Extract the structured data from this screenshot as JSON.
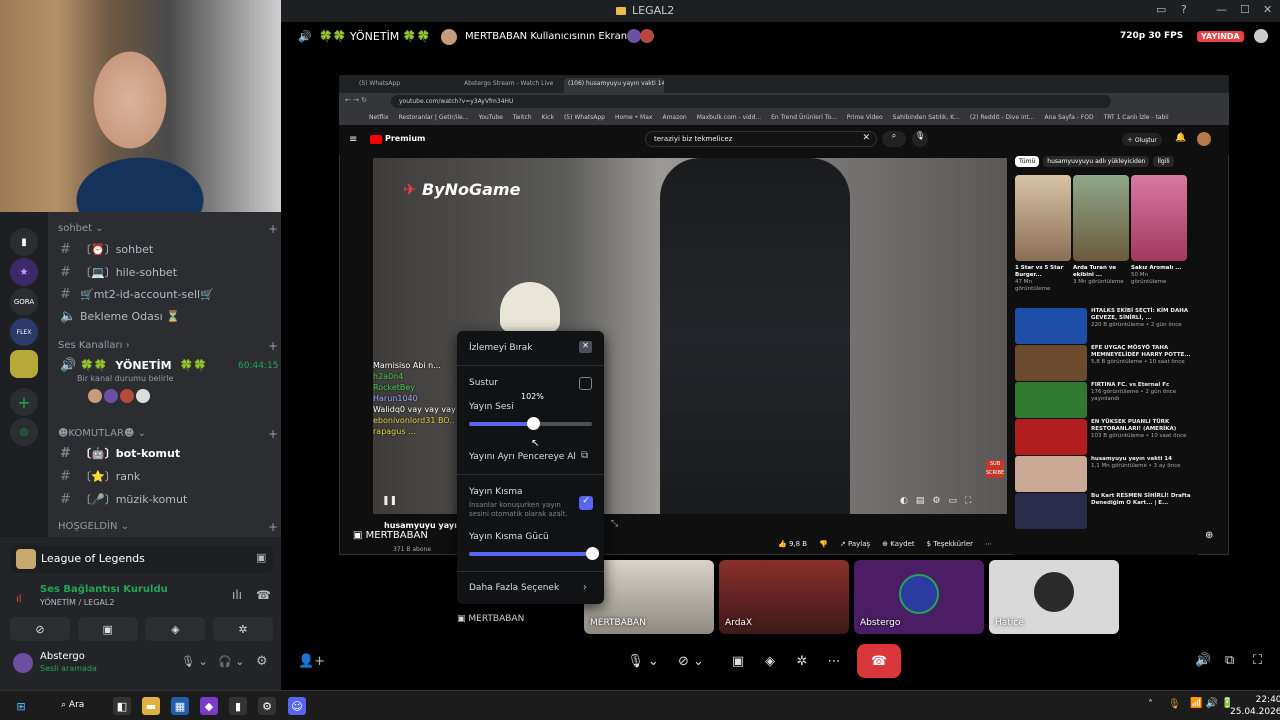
{
  "window": {
    "title": "LEGAL2"
  },
  "sidebar": {
    "categories": {
      "sohbet": "sohbet",
      "voice": "Ses Kanalları",
      "komutlar": "☻KOMUTLAR☻",
      "hosgeldin": "HOŞGELDİN"
    },
    "channels": [
      {
        "label": "〔⏰〕sohbet"
      },
      {
        "label": "〔💻〕hile-sohbet"
      },
      {
        "label": "🛒mt2-id-account-sell🛒"
      },
      {
        "label": "Bekleme Odası ⏳"
      },
      {
        "label": "〔🤖〕bot-komut"
      },
      {
        "label": "〔⭐〕rank"
      },
      {
        "label": "〔🎤〕müzik-komut"
      }
    ],
    "voice_channel": {
      "name": "YÖNETİM",
      "timer": "60:44:15",
      "status": "Bir kanal durumu belirle"
    }
  },
  "status_panel": {
    "activity": "League of Legends",
    "connection": "Ses Bağlantısı Kuruldu",
    "connection_path": "YÖNETİM / LEGAL2",
    "user": {
      "name": "Abstergo",
      "status": "Sesli aramada"
    }
  },
  "stage": {
    "channel": "YÖNETİM",
    "screen_owner": "MERTBABAN Kullanıcısının Ekranı",
    "quality": "720p 30 FPS",
    "live_badge": "YAYINDA",
    "tile_names": [
      "MERTBABAN",
      "MERTBABAN",
      "ArdaX",
      "Abstergo",
      "Hatice"
    ]
  },
  "browser": {
    "tabs": [
      "(5) WhatsApp",
      "Abstergo Stream - Watch Live",
      "(106) husamyuyu yayın vakti 14"
    ],
    "url": "youtube.com/watch?v=y3AyVfm34HU",
    "bookmarks": [
      "Netflix",
      "Restoranlar | Getir/ile...",
      "YouTube",
      "Twitch",
      "Kick",
      "(5) WhatsApp",
      "Home • Max",
      "Amazon",
      "Maxbulk.com - vidd...",
      "En Trend Ürünleri To...",
      "Prime Video",
      "Sahibinden Satılık, K...",
      "(2) Reddit - Dive int...",
      "Ana Sayfa - FOD",
      "TRT 1 Canlı İzle - tabii"
    ],
    "search_query": "teraziyi biz tekmelicez",
    "logo": "Premium",
    "create_btn": "Oluştur"
  },
  "youtube": {
    "brand": "ByNoGame",
    "chips": [
      "Tümü",
      "husamyuvyuyu adlı yükleyiciden",
      "İlgili"
    ],
    "shorts": [
      {
        "title": "1 Star vs 5 Star Burger...",
        "views": "47 Mn görüntüleme"
      },
      {
        "title": "Arda Turan ve ekibini ...",
        "views": "3 Mn görüntüleme"
      },
      {
        "title": "Sakız Aromalı ...",
        "views": "50 Mn görüntüleme"
      }
    ],
    "videos": [
      {
        "title": "HTALKS EKİBİ SEÇTİ: KİM DAHA GEVEZE, SİNİRLİ, ...",
        "meta": "220 B görüntüleme • 2 gün önce"
      },
      {
        "title": "EFE UYGAÇ MÖSYÖ TAHA MEMNEYELİDEF HARRY POTTE...",
        "meta": "5,8 B görüntüleme • 10 saat önce"
      },
      {
        "title": "FIRTINA FC. vs Eternal Fc",
        "meta": "176 görüntüleme • 2 gün önce yayınlandı"
      },
      {
        "title": "EN YÜKSEK PUANLI TÜRK RESTORANLARI! (AMERİKA)",
        "meta": "103 B görüntüleme • 10 saat önce"
      },
      {
        "title": "husamyuyu yayın vakti 14",
        "meta": "1,1 Mn görüntüleme • 3 ay önce"
      },
      {
        "title": "Bu Kart RESMEN SİHİRLİ! Drafta Denediğim O Kart... | E...",
        "meta": ""
      }
    ],
    "video_title": "husamyuyu yayın vakt",
    "channel": "MERTBABAN",
    "subs": "371 B abone",
    "likes": "9,8 B",
    "share": "Paylaş",
    "save": "Kaydet",
    "thanks": "Teşekkürler"
  },
  "chat": [
    "Mamisiso Abi n...",
    "h2a0n4",
    "RocketBey",
    "Harun1040",
    "Walidq0 vay vay vay",
    "ebonivonlord31 BO..",
    "rapagus ..."
  ],
  "menu": {
    "stop_watching": "İzlemeyi Bırak",
    "mute": "Sustur",
    "volume_label": "Yayın Sesi",
    "volume_value": "102%",
    "volume_level": 0.52,
    "popout": "Yayını Ayrı Pencereye Al",
    "attenuation": "Yayın Kısma",
    "attenuation_desc": "İnsanlar konuşurken yayın sesini otomatik olarak azalt.",
    "attenuation_checked": true,
    "attenuation_strength": "Yayın Kısma Gücü",
    "attenuation_level": 1.0,
    "more": "Daha Fazla Seçenek"
  },
  "taskbar": {
    "search": "Ara",
    "time": "22:40",
    "date": "25.04.2026"
  },
  "colors": {
    "accent": "#5865f2",
    "live": "#ed4245",
    "green": "#23a559",
    "end_call": "#da373c"
  }
}
